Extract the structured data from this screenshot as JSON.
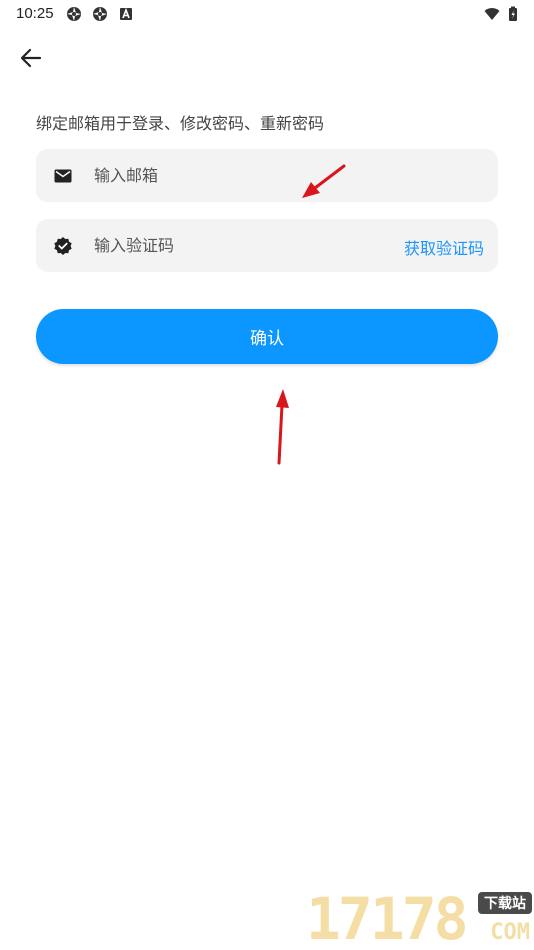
{
  "status_bar": {
    "time": "10:25",
    "left_icons": [
      "aperture-icon",
      "aperture-icon",
      "a-icon"
    ],
    "right_icons": [
      "wifi-icon",
      "battery-icon"
    ]
  },
  "header": {
    "back_icon": "arrow-left-icon"
  },
  "form": {
    "hint": "绑定邮箱用于登录、修改密码、重新密码",
    "email": {
      "icon": "mail-icon",
      "placeholder": "输入邮箱",
      "value": ""
    },
    "code": {
      "icon": "verified-icon",
      "placeholder": "输入验证码",
      "value": "",
      "action_label": "获取验证码"
    },
    "confirm_label": "确认"
  },
  "watermark": {
    "digits": "17178",
    "badge": "下载站",
    "suffix": "COM"
  },
  "colors": {
    "accent": "#0b97ff",
    "link": "#1a94ff",
    "field_bg": "#f3f3f3",
    "annotation_arrow": "#d9161c"
  }
}
